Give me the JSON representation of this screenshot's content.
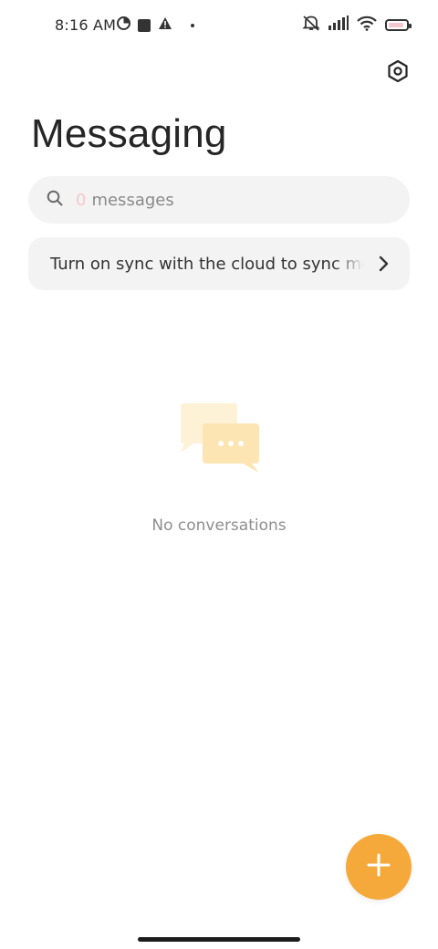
{
  "status_bar": {
    "time": "8:16 AM",
    "icons": [
      "pie-chart-icon",
      "square-icon",
      "warning-icon",
      "dot-icon",
      "mute-icon",
      "signal-icon",
      "wifi-icon",
      "battery-icon"
    ]
  },
  "header": {
    "title": "Messaging",
    "settings_icon": "settings-hex-icon"
  },
  "search": {
    "count": "0",
    "label": "messages",
    "icon": "search-icon"
  },
  "sync_banner": {
    "text": "Turn on sync with the cloud to sync messages",
    "icon": "chevron-right-icon"
  },
  "empty_state": {
    "illustration": "chat-bubbles-icon",
    "text": "No conversations"
  },
  "fab": {
    "icon": "plus-icon"
  },
  "colors": {
    "accent": "#f5a93a",
    "surface": "#f3f3f3",
    "text": "#262626",
    "muted": "#8e8e8e",
    "illustration_back": "#fdf1d6",
    "illustration_front": "#fce5b3"
  }
}
